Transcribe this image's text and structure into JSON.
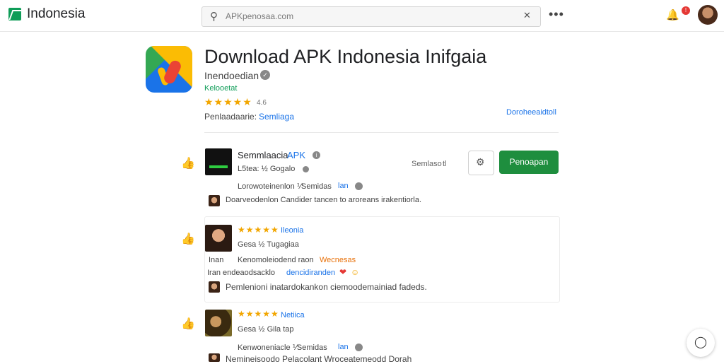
{
  "header": {
    "brand": "Indonesia",
    "search_placeholder": "APKpenosaa.com",
    "search_icon": "search-icon",
    "clear_icon": "clear-icon",
    "more_label": "•••",
    "notification_count": "!"
  },
  "app": {
    "title": "Download APK Indonesia Inifgaia",
    "developer": "Inendoedian",
    "category": "Kelooetat",
    "stars": "★★★★★",
    "rating": "4.6",
    "meta_label": "Penlaadaarie:",
    "meta_value": "Semliaga",
    "download_link": "Doroheeaidtoll"
  },
  "reviews": [
    {
      "title": "Semmlaacia",
      "badge": "APK",
      "date": "L5tea:  ½ Gogalo",
      "line1_a": "Lorowoteinenlon  ⅟Semidas",
      "line1_b": "lan",
      "comment": "Doarveodenlon Candider tancen to aroreans irakentiorla.",
      "size_label": "Semlaso",
      "size_suffix": "tl",
      "action_label": "Penoapan"
    },
    {
      "stars": "★★★★★",
      "title": "Ileonia",
      "date": "Gesa  ½ Tugagiaa",
      "line1_a": "Inan",
      "line1_b": "Kenomoleiodend raon",
      "line1_c": "Wecnesas",
      "line2_a": "Iran endeaodsacklo",
      "line2_b": "dencidiranden",
      "comment": "Pemlenioni inatardokankon ciemoodemainiad fadeds."
    },
    {
      "stars": "★★★★★",
      "title": "Netiica",
      "date": "Gesa  ½ Gila tap",
      "line1_a": "Kenwoneniacle  ⅟Semidas",
      "line1_b": "lan",
      "comment": "Nemineisoodo  Pelacolant  Wroceatemeodd Dorah"
    }
  ]
}
